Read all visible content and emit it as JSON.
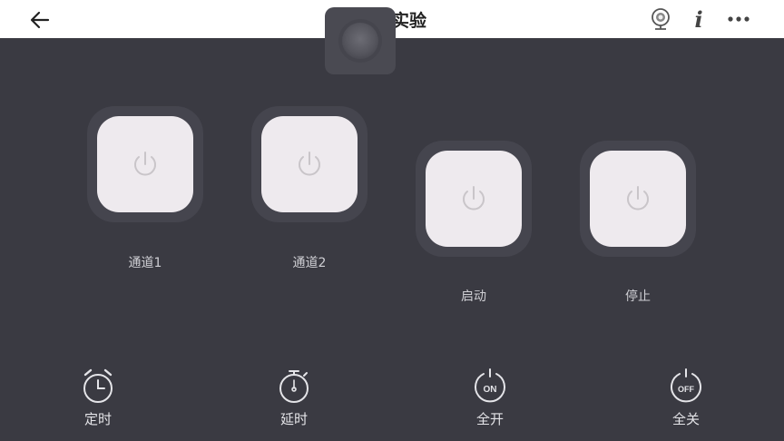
{
  "header": {
    "title": "电路实验"
  },
  "switches": [
    {
      "label": "通道1"
    },
    {
      "label": "通道2"
    },
    {
      "label": "启动"
    },
    {
      "label": "停止"
    }
  ],
  "bottom_bar": [
    {
      "label": "定时",
      "icon": "alarm-clock-icon"
    },
    {
      "label": "延时",
      "icon": "stopwatch-icon"
    },
    {
      "label": "全开",
      "icon": "power-on-icon",
      "badge": "ON"
    },
    {
      "label": "全关",
      "icon": "power-off-icon",
      "badge": "OFF"
    }
  ],
  "colors": {
    "background": "#3a3a42",
    "switch_face": "#eeeaee",
    "header_bg": "#ffffff"
  }
}
